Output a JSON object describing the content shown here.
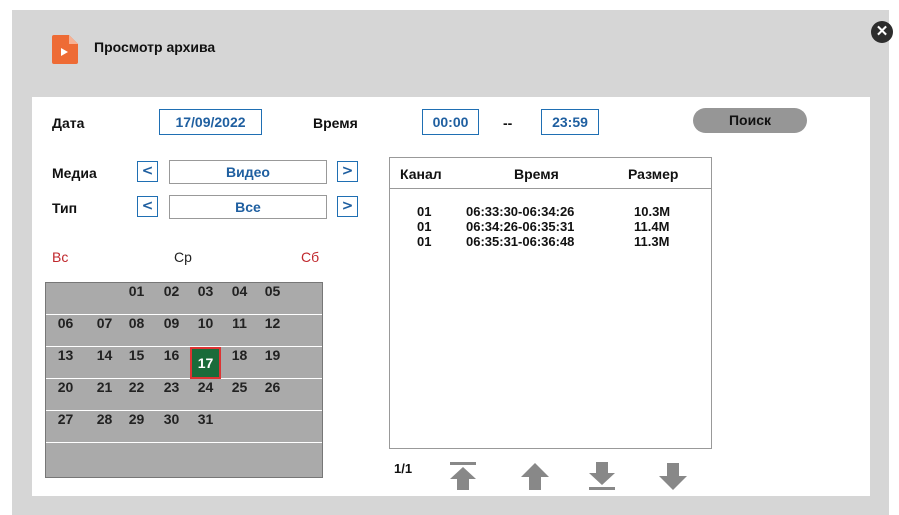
{
  "window": {
    "title": "Просмотр архива",
    "close_glyph": "✕"
  },
  "search": {
    "date_label": "Дата",
    "date_value": "17/09/2022",
    "time_label": "Время",
    "time_from": "00:00",
    "time_separator": "--",
    "time_to": "23:59",
    "search_button": "Поиск"
  },
  "filters": {
    "media_label": "Медиа",
    "media_value": "Видео",
    "type_label": "Тип",
    "type_value": "Все",
    "prev_glyph": "<",
    "next_glyph": ">"
  },
  "calendar": {
    "weekday_sun": "Вс",
    "weekday_wed": "Ср",
    "weekday_sat": "Сб",
    "rows": [
      [
        "",
        "",
        "01",
        "02",
        "03",
        "04",
        "05"
      ],
      [
        "06",
        "07",
        "08",
        "09",
        "10",
        "11",
        "12"
      ],
      [
        "13",
        "14",
        "15",
        "16",
        "17",
        "18",
        "19"
      ],
      [
        "20",
        "21",
        "22",
        "23",
        "24",
        "25",
        "26"
      ],
      [
        "27",
        "28",
        "29",
        "30",
        "31",
        "",
        ""
      ]
    ],
    "selected_day": "17",
    "colors": {
      "weekend": "#c0282d",
      "selected": "#1a6b3a",
      "selected_border": "#d33333"
    }
  },
  "results": {
    "headers": {
      "channel": "Канал",
      "time": "Время",
      "size": "Размер"
    },
    "rows": [
      {
        "channel": "01",
        "time": "06:33:30-06:34:26",
        "size": "10.3M"
      },
      {
        "channel": "01",
        "time": "06:34:26-06:35:31",
        "size": "11.4M"
      },
      {
        "channel": "01",
        "time": "06:35:31-06:36:48",
        "size": "11.3M"
      }
    ],
    "page": "1/1"
  },
  "icons": {
    "app": "play-file-icon",
    "close": "close-icon",
    "first": "first-page-icon",
    "up": "page-up-icon",
    "last": "last-page-icon",
    "down": "page-down-icon"
  },
  "colors": {
    "accent": "#1f5fa0",
    "app_icon": "#ee6b35",
    "frame": "#d6d6d6",
    "search_button": "#969696"
  }
}
